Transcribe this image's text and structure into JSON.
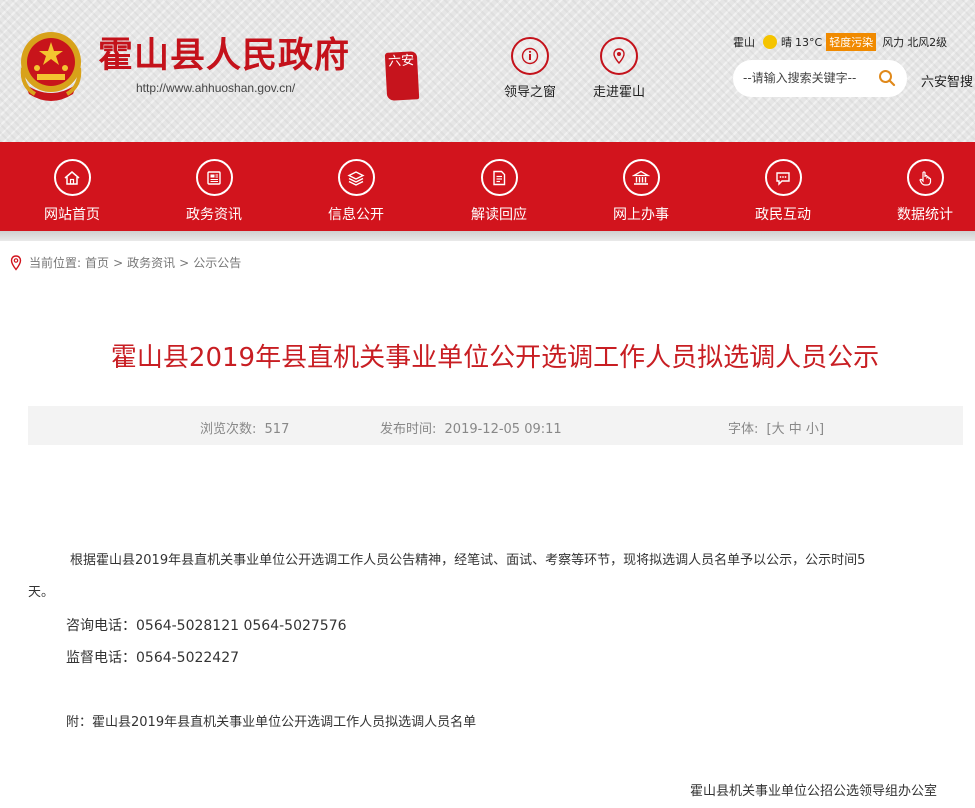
{
  "header": {
    "site_title": "霍山县人民政府",
    "site_url": "http://www.ahhuoshan.gov.cn/",
    "seal_text": "六安",
    "links": [
      {
        "label": "领导之窗",
        "icon": "leader-icon"
      },
      {
        "label": "走进霍山",
        "icon": "location-pin-icon"
      }
    ],
    "weather": {
      "city": "霍山",
      "condition": "晴",
      "temperature": "13°C",
      "air_quality": "轻度污染",
      "wind_label": "风力",
      "wind_value": "北风2级"
    },
    "search": {
      "placeholder": "--请输入搜索关键字--"
    },
    "liuan_search": "六安智搜"
  },
  "nav": {
    "items": [
      {
        "label": "网站首页",
        "icon": "home-icon"
      },
      {
        "label": "政务资讯",
        "icon": "news-icon"
      },
      {
        "label": "信息公开",
        "icon": "layers-icon"
      },
      {
        "label": "解读回应",
        "icon": "document-icon"
      },
      {
        "label": "网上办事",
        "icon": "building-icon"
      },
      {
        "label": "政民互动",
        "icon": "chat-icon"
      },
      {
        "label": "数据统计",
        "icon": "hand-pointer-icon"
      }
    ]
  },
  "breadcrumb": {
    "prefix": "当前位置:",
    "items": [
      "首页",
      "政务资讯",
      "公示公告"
    ],
    "separator": ">"
  },
  "article": {
    "title": "霍山县2019年县直机关事业单位公开选调工作人员拟选调人员公示",
    "views_label": "浏览次数:",
    "views": "517",
    "date_label": "发布时间:",
    "date": "2019-12-05 09:11",
    "font_label": "字体:",
    "font_open": "[",
    "font_large": "大",
    "font_medium": "中",
    "font_small": "小",
    "font_close": "]",
    "paragraph_line1": "根据霍山县2019年县直机关事业单位公开选调工作人员公告精神，经笔试、面试、考察等环节，现将拟选调人员名单予以公示，公示时间5",
    "paragraph_line2": "天。",
    "consult_phone": "咨询电话：0564-5028121  0564-5027576",
    "supervise_phone": "监督电话：0564-5022427",
    "attachment": "附：霍山县2019年县直机关事业单位公开选调工作人员拟选调人员名单",
    "signature": "霍山县机关事业单位公招公选领导组办公室"
  },
  "colors": {
    "brand_red": "#d2141d",
    "title_red": "#c81e23",
    "sun_yellow": "#f5c400",
    "air_quality_orange": "#f08a00"
  }
}
